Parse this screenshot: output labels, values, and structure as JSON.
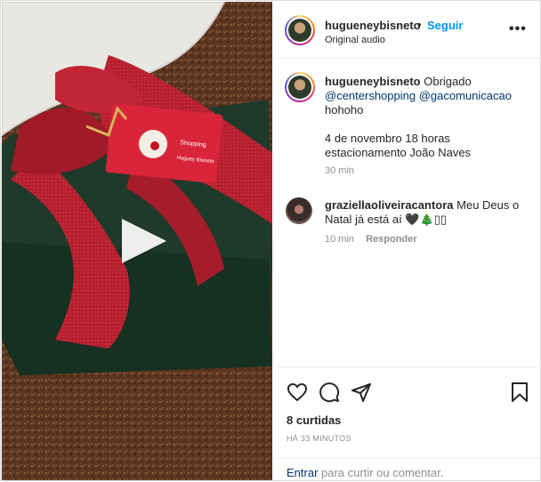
{
  "post": {
    "username": "hugueneybisneto",
    "separator": "•",
    "follow_label": "Seguir",
    "audio_label": "Original audio",
    "more_label": "•••"
  },
  "caption": {
    "username": "hugueneybisneto",
    "text_start": "Obrigado",
    "mention1": "@centershopping",
    "mention2": "@gacomunicacao",
    "line2": "hohoho",
    "line3": "4 de novembro 18 horas",
    "line4": "estacionamento João Naves",
    "time": "30 min"
  },
  "comment": {
    "username": "graziellaoliveiracantora",
    "text": "Meu Deus o Natal já está aí 🖤🎄▯▯",
    "time": "10 min",
    "reply_label": "Responder"
  },
  "actions": {
    "likes": "8 curtidas",
    "posted": "HÁ 33 MINUTOS",
    "icons": [
      "heart-icon",
      "comment-icon",
      "share-icon",
      "bookmark-icon"
    ]
  },
  "login": {
    "link": "Entrar",
    "rest": " para curtir ou comentar."
  },
  "media": {
    "tag_text_1": "Shopping",
    "tag_text_2": "Huguey Bisneto",
    "play_icon": "play-icon"
  },
  "colors": {
    "follow": "#0095f6",
    "mention": "#00376b",
    "ribbon": "#b01e2d",
    "box": "#1f3a2a"
  }
}
